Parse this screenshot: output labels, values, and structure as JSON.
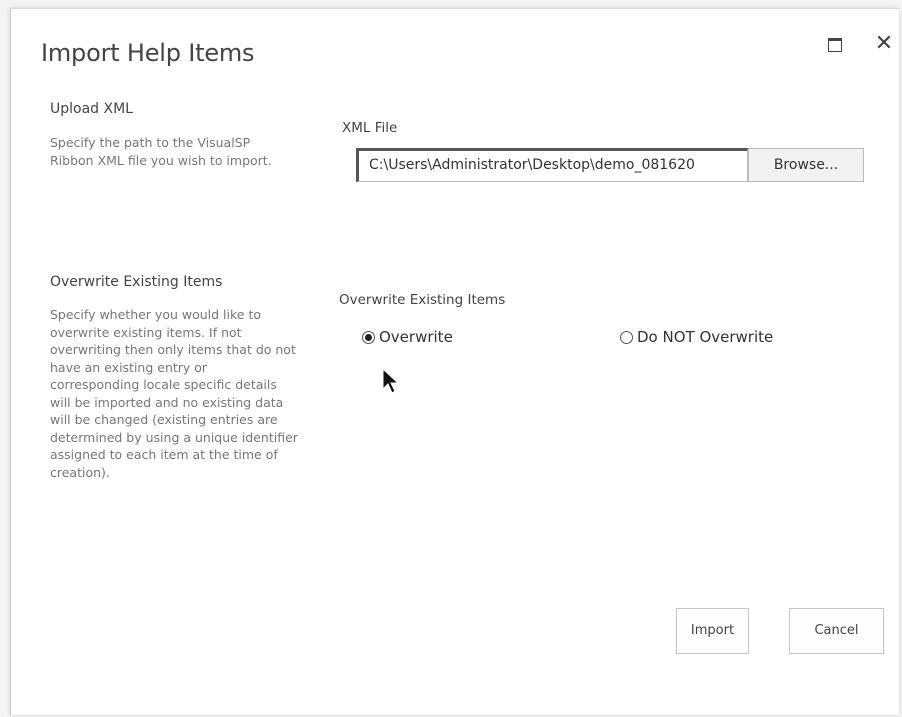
{
  "dialog": {
    "title": "Import Help Items",
    "maximize_icon": "maximize-icon",
    "close_icon": "close-icon",
    "close_glyph": "✕"
  },
  "upload_section": {
    "heading": "Upload XML",
    "description": "Specify the path to the VisualSP Ribbon XML file you wish to import.",
    "field_label": "XML File",
    "file_value": "C:\\Users\\Administrator\\Desktop\\demo_081620",
    "browse_label": "Browse..."
  },
  "overwrite_section": {
    "heading": "Overwrite Existing Items",
    "description": "Specify whether you would like to overwrite existing items. If not overwriting then only items that do not have an existing entry or corresponding locale specific details will be imported and no existing data will be changed (existing entries are determined by using a unique identifier assigned to each item at the time of creation).",
    "field_label": "Overwrite Existing Items",
    "options": [
      {
        "label": "Overwrite",
        "selected": true
      },
      {
        "label": "Do NOT Overwrite",
        "selected": false
      }
    ]
  },
  "actions": {
    "import_label": "Import",
    "cancel_label": "Cancel"
  }
}
